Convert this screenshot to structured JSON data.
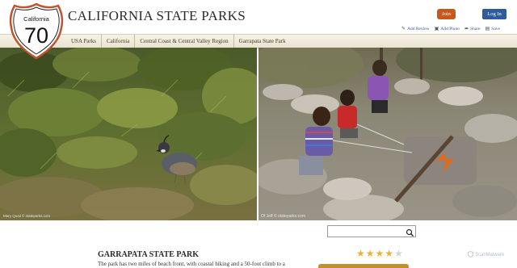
{
  "header": {
    "logo": {
      "state": "California",
      "number": "70"
    },
    "title": "CALIFORNIA STATE PARKS",
    "join_label": "Join",
    "login_label": "Log In",
    "actions": [
      {
        "icon": "pencil-icon",
        "label": "Add Review"
      },
      {
        "icon": "camera-icon",
        "label": "Add Photo"
      },
      {
        "icon": "share-icon",
        "label": "Share"
      },
      {
        "icon": "save-icon",
        "label": "Save"
      }
    ]
  },
  "nav": {
    "items": [
      {
        "label": "USA Parks"
      },
      {
        "label": "California"
      },
      {
        "label": "Central Coast & Central Valley Region"
      },
      {
        "label": "Garrapata State Park"
      }
    ]
  },
  "photos": {
    "left_caption": "Mary Quail © stateparks.com",
    "right_caption": "Of Jeff © stateparks.com"
  },
  "search": {
    "placeholder": "",
    "icon": "search-icon"
  },
  "park": {
    "title": "GARRAPATA STATE PARK",
    "description": "The park has two miles of beach front, with coastal hiking and a 50-foot climb to a"
  },
  "rating": {
    "value": 4,
    "max": 5
  },
  "watermark": {
    "label": "ScanMalware"
  },
  "colors": {
    "join": "#c5581a",
    "login": "#2d5b9e",
    "nav_bg": "#efe9d8",
    "star": "#e9b33a",
    "rating_bar": "#c38e2c"
  }
}
